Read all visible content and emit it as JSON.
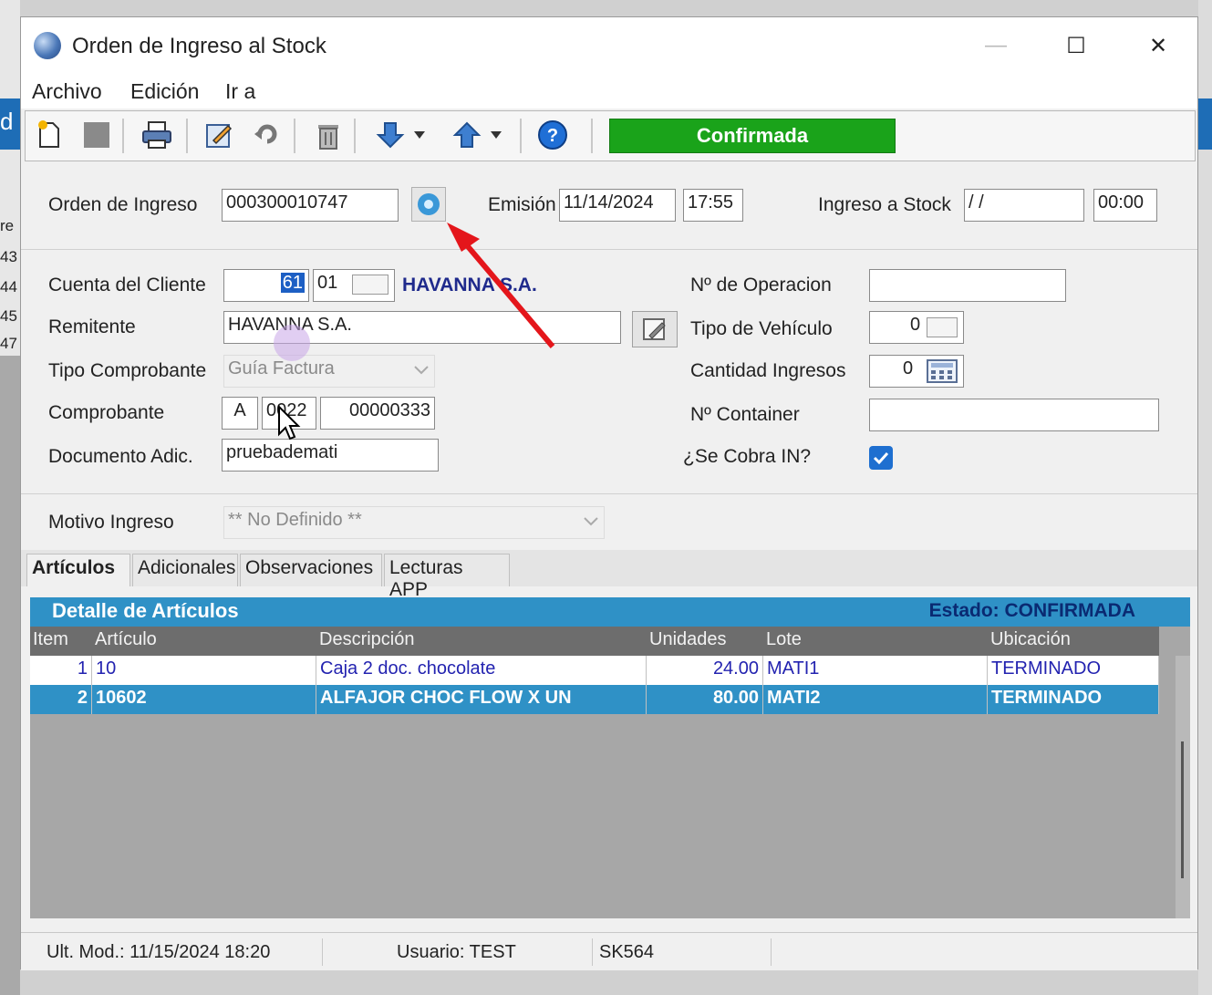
{
  "background": {
    "left_partial": [
      "d",
      "re",
      "43",
      "44",
      "45",
      "47"
    ]
  },
  "window": {
    "title": "Orden de Ingreso al Stock",
    "minimize": "—",
    "maximize": "☐",
    "close": "✕"
  },
  "menu": {
    "archivo": "Archivo",
    "edicion": "Edición",
    "ir_a": "Ir a"
  },
  "toolbar": {
    "icons": [
      "new-document-icon",
      "save-icon",
      "print-icon",
      "edit-icon",
      "undo-icon",
      "delete-icon",
      "down-arrow-icon",
      "up-arrow-icon",
      "help-icon"
    ],
    "status": "Confirmada",
    "status_color": "#1aa31a"
  },
  "header": {
    "orden_label": "Orden de Ingreso",
    "orden_value": "000300010747",
    "emision_label": "Emisión",
    "emision_date": "11/14/2024",
    "emision_time": "17:55",
    "ingreso_label": "Ingreso a Stock",
    "ingreso_date": " / /",
    "ingreso_time": "00:00"
  },
  "form": {
    "cuenta_label": "Cuenta del Cliente",
    "cuenta_code": "61",
    "cuenta_sub": "01",
    "cliente_name": "HAVANNA S.A.",
    "remitente_label": "Remitente",
    "remitente_value": "HAVANNA S.A.",
    "tipo_comp_label": "Tipo Comprobante",
    "tipo_comp_value": "Guía Factura",
    "comprobante_label": "Comprobante",
    "comp_letra": "A",
    "comp_pv": "0022",
    "comp_num": "00000333",
    "doc_adic_label": "Documento Adic.",
    "doc_adic_value": "pruebademati",
    "nro_operacion_label": "Nº de Operacion",
    "nro_operacion_value": "",
    "tipo_vehiculo_label": "Tipo de Vehículo",
    "tipo_vehiculo_value": "0",
    "cantidad_label": "Cantidad Ingresos",
    "cantidad_value": "0",
    "container_label": "Nº Container",
    "container_value": "",
    "cobra_label": "¿Se Cobra IN?",
    "cobra_checked": true,
    "motivo_label": "Motivo Ingreso",
    "motivo_value": "** No Definido **"
  },
  "tabs": [
    "Artículos",
    "Adicionales",
    "Observaciones",
    "Lecturas APP"
  ],
  "grid": {
    "title": "Detalle de Artículos",
    "estado": "Estado: CONFIRMADA",
    "columns": [
      "Item",
      "Artículo",
      "Descripción",
      "Unidades",
      "Lote",
      "Ubicación"
    ],
    "rows": [
      [
        "1",
        "10",
        "Caja 2 doc. chocolate",
        "24.00",
        "MATI1",
        "TERMINADO"
      ],
      [
        "2",
        "10602",
        "ALFAJOR CHOC FLOW X UN",
        "80.00",
        "MATI2",
        "TERMINADO"
      ]
    ]
  },
  "statusbar": {
    "ult_mod": "Ult. Mod.: 11/15/2024 18:20",
    "usuario": "Usuario: TEST",
    "code": "SK564"
  }
}
